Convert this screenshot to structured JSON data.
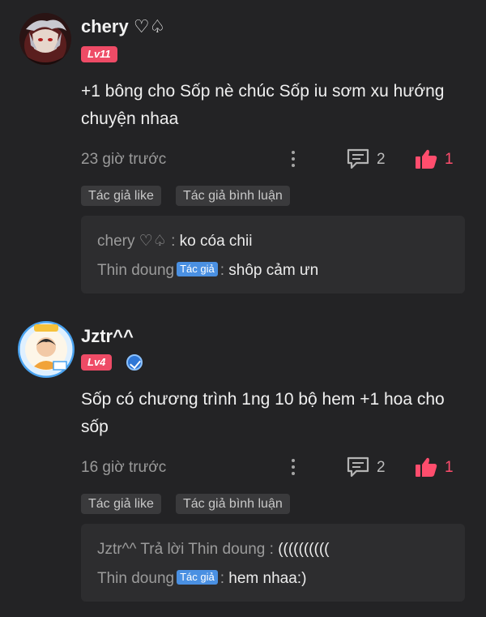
{
  "comments": [
    {
      "username": "chery ♡♤",
      "level": "Lv11",
      "text": "+1 bông cho Sốp nè chúc Sốp iu sơm xu hướng chuyện nhaa",
      "time": "23 giờ trước",
      "reply_count": "2",
      "like_count": "1",
      "tags": [
        "Tác giả like",
        "Tác giả bình luận"
      ],
      "replies": [
        {
          "name": "chery ♡♤",
          "author_badge": "",
          "text": "ko cóa chii"
        },
        {
          "name": "Thin doung",
          "author_badge": "Tác giả",
          "text": "shôp cảm ưn"
        }
      ]
    },
    {
      "username": "Jztr^^",
      "level": "Lv4",
      "text": "Sốp có chương trình 1ng 10 bộ hem +1 hoa cho sốp",
      "time": "16 giờ trước",
      "reply_count": "2",
      "like_count": "1",
      "tags": [
        "Tác giả like",
        "Tác giả bình luận"
      ],
      "replies": [
        {
          "name": "Jztr^^ Trả lời Thin doung",
          "author_badge": "",
          "text": "(((((((((("
        },
        {
          "name": "Thin doung",
          "author_badge": "Tác giả",
          "text": "hem nhaa:)"
        }
      ]
    }
  ],
  "colors": {
    "background": "#232325",
    "like": "#ff4d6d",
    "level_badge": "#ee4b66",
    "author_badge": "#4a90e2"
  },
  "icons": [
    "more-vertical-icon",
    "reply-icon",
    "thumbs-up-icon",
    "verified-icon"
  ]
}
